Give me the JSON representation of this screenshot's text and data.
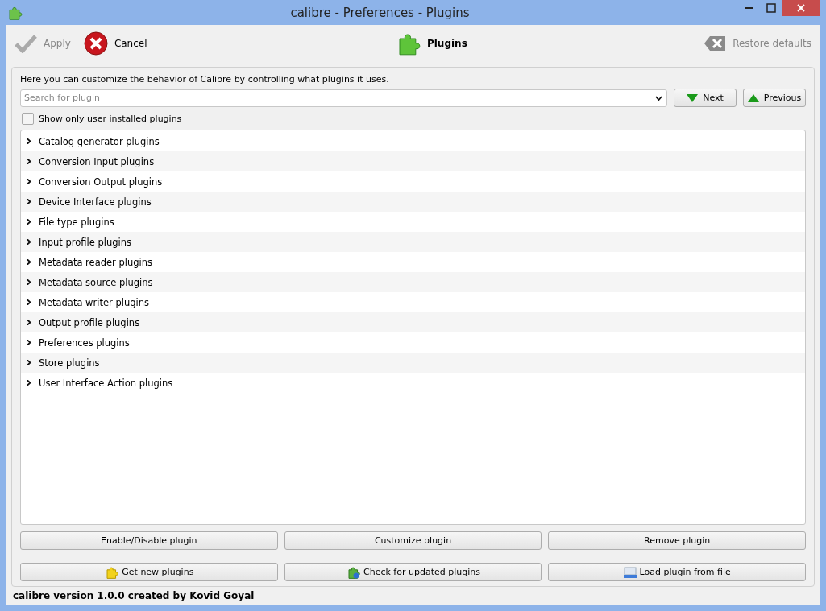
{
  "window": {
    "title": "calibre - Preferences - Plugins"
  },
  "toolbar": {
    "actions": [
      {
        "label": "Apply",
        "kind": "apply",
        "disabled": true
      },
      {
        "label": "Cancel",
        "kind": "cancel",
        "disabled": false
      }
    ],
    "section_title": "Plugins",
    "restore": {
      "label": "Restore defaults",
      "disabled": true
    }
  },
  "description": "Here you can customize the behavior of Calibre by controlling what plugins it uses.",
  "search": {
    "placeholder": "Search for plugin"
  },
  "nav_buttons": [
    {
      "label": "Next",
      "kind": "down"
    },
    {
      "label": "Previous",
      "kind": "up"
    }
  ],
  "user_only": {
    "label": "Show only user installed plugins",
    "checked": false
  },
  "tree": [
    {
      "label": "Catalog generator plugins",
      "expanded": false
    },
    {
      "label": "Conversion Input plugins",
      "expanded": false
    },
    {
      "label": "Conversion Output plugins",
      "expanded": false
    },
    {
      "label": "Device Interface plugins",
      "expanded": false
    },
    {
      "label": "File type plugins",
      "expanded": false
    },
    {
      "label": "Input profile plugins",
      "expanded": false
    },
    {
      "label": "Metadata reader plugins",
      "expanded": false
    },
    {
      "label": "Metadata source plugins",
      "expanded": false
    },
    {
      "label": "Metadata writer plugins",
      "expanded": false
    },
    {
      "label": "Output profile plugins",
      "expanded": false
    },
    {
      "label": "Preferences plugins",
      "expanded": false
    },
    {
      "label": "Store plugins",
      "expanded": false
    },
    {
      "label": "User Interface Action plugins",
      "expanded": false
    }
  ],
  "buttons": [
    {
      "label": "Enable/Disable plugin",
      "kind": "plain"
    },
    {
      "label": "Customize plugin",
      "kind": "plain"
    },
    {
      "label": "Remove plugin",
      "kind": "plain"
    },
    {
      "label": "Get new plugins",
      "kind": "get"
    },
    {
      "label": "Check for updated plugins",
      "kind": "check"
    },
    {
      "label": "Load plugin from file",
      "kind": "load"
    }
  ],
  "status_bar": "calibre version 1.0.0 created by Kovid Goyal"
}
